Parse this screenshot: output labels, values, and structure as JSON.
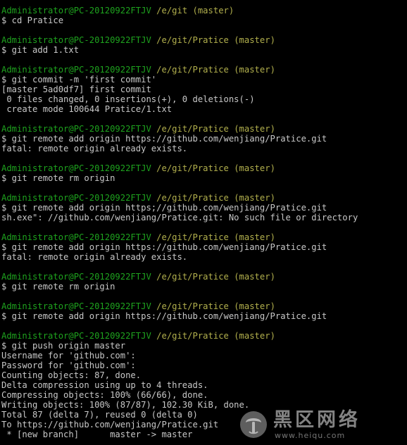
{
  "prompt": {
    "user_host": "Administrator@PC-20120922FTJV",
    "path_git": "/e/git (master)",
    "path_pratice": "/e/git/Pratice (master)"
  },
  "lines": [
    {
      "type": "prompt",
      "path": "/e/git (master)"
    },
    {
      "type": "text",
      "text": "$ cd Pratice"
    },
    {
      "type": "blank"
    },
    {
      "type": "prompt",
      "path": "/e/git/Pratice (master)"
    },
    {
      "type": "text",
      "text": "$ git add 1.txt"
    },
    {
      "type": "blank"
    },
    {
      "type": "prompt",
      "path": "/e/git/Pratice (master)"
    },
    {
      "type": "text",
      "text": "$ git commit -m 'first commit'"
    },
    {
      "type": "text",
      "text": "[master 5ad0df7] first commit"
    },
    {
      "type": "text",
      "text": " 0 files changed, 0 insertions(+), 0 deletions(-)"
    },
    {
      "type": "text",
      "text": " create mode 100644 Pratice/1.txt"
    },
    {
      "type": "blank"
    },
    {
      "type": "prompt",
      "path": "/e/git/Pratice (master)"
    },
    {
      "type": "text",
      "text": "$ git remote add origin https://github.com/wenjiang/Pratice.git"
    },
    {
      "type": "text",
      "text": "fatal: remote origin already exists."
    },
    {
      "type": "blank"
    },
    {
      "type": "prompt",
      "path": "/e/git/Pratice (master)"
    },
    {
      "type": "text",
      "text": "$ git remote rm origin"
    },
    {
      "type": "blank"
    },
    {
      "type": "prompt",
      "path": "/e/git/Pratice (master)"
    },
    {
      "type": "text",
      "text": "$ git remote add origin https;//github.com/wenjiang/Pratice.git"
    },
    {
      "type": "text",
      "text": "sh.exe\": //github.com/wenjiang/Pratice.git: No such file or directory"
    },
    {
      "type": "blank"
    },
    {
      "type": "prompt",
      "path": "/e/git/Pratice (master)"
    },
    {
      "type": "text",
      "text": "$ git remote add origin https://github.com/wenjiang/Pratice.git"
    },
    {
      "type": "text",
      "text": "fatal: remote origin already exists."
    },
    {
      "type": "blank"
    },
    {
      "type": "prompt",
      "path": "/e/git/Pratice (master)"
    },
    {
      "type": "text",
      "text": "$ git remote rm origin"
    },
    {
      "type": "blank"
    },
    {
      "type": "prompt",
      "path": "/e/git/Pratice (master)"
    },
    {
      "type": "text",
      "text": "$ git remote add origin https://github.com/wenjiang/Pratice.git"
    },
    {
      "type": "blank"
    },
    {
      "type": "prompt",
      "path": "/e/git/Pratice (master)"
    },
    {
      "type": "text",
      "text": "$ git push origin master"
    },
    {
      "type": "text",
      "text": "Username for 'github.com':"
    },
    {
      "type": "text",
      "text": "Password for 'github.com':"
    },
    {
      "type": "text",
      "text": "Counting objects: 87, done."
    },
    {
      "type": "text",
      "text": "Delta compression using up to 4 threads."
    },
    {
      "type": "text",
      "text": "Compressing objects: 100% (66/66), done."
    },
    {
      "type": "text",
      "text": "Writing objects: 100% (87/87), 102.30 KiB, done."
    },
    {
      "type": "text",
      "text": "Total 87 (delta 7), reused 0 (delta 0)"
    },
    {
      "type": "text",
      "text": "To https://github.com/wenjiang/Pratice.git"
    },
    {
      "type": "text",
      "text": " * [new branch]      master -> master"
    }
  ],
  "watermark": {
    "title": "黑区网络",
    "url": "www.heiqu.com"
  },
  "colors": {
    "background": "#000000",
    "text": "#c8c8c8",
    "user_host": "#1ea31e",
    "path": "#b2b04d"
  }
}
